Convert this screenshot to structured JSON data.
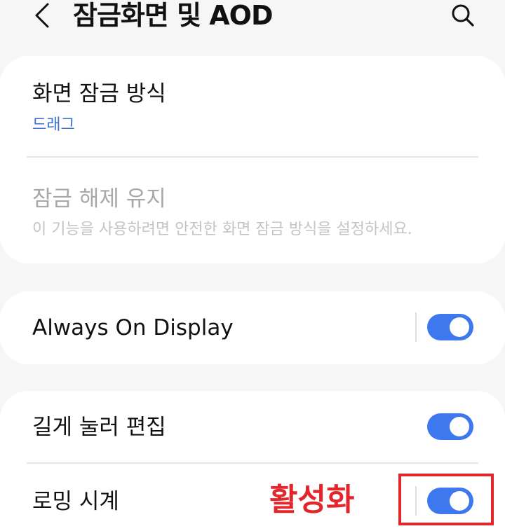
{
  "header": {
    "title": "잠금화면 및 AOD",
    "back_icon": "chevron-left-icon",
    "search_icon": "search-icon"
  },
  "lock_card": {
    "screen_lock_type": {
      "title": "화면 잠금 방식",
      "value": "드래그"
    },
    "keep_unlocked": {
      "title": "잠금 해제 유지",
      "description": "이 기능을 사용하려면 안전한 화면 잠금 방식을 설정하세요.",
      "enabled": false
    }
  },
  "aod_card": {
    "always_on_display": {
      "title": "Always On Display",
      "toggle_on": true
    }
  },
  "extra_card": {
    "long_press_edit": {
      "title": "길게 눌러 편집",
      "toggle_on": true
    },
    "roaming_clock": {
      "title": "로밍 시계",
      "toggle_on": true
    }
  },
  "annotation": {
    "label": "활성화",
    "color": "#e3262b"
  },
  "colors": {
    "accent": "#3e78ee",
    "link": "#3a6fd0",
    "background": "#f6f6f6",
    "card": "#ffffff"
  }
}
